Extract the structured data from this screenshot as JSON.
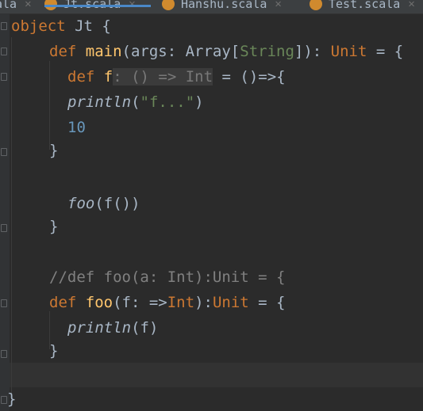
{
  "tabs": [
    {
      "label": "ala",
      "active": false
    },
    {
      "label": "Jt.scala",
      "active": true
    },
    {
      "label": "Hanshu.scala",
      "active": false
    },
    {
      "label": "Test.scala",
      "active": false
    }
  ],
  "code": {
    "l1": {
      "kw": "object",
      "name": " Jt {"
    },
    "l2": {
      "kw": "def ",
      "fn": "main",
      "p1": "(args: Array[",
      "ty": "String",
      "p2": "]): ",
      "unit": "Unit",
      "p3": " = {"
    },
    "l3": {
      "kw": "def ",
      "name": "f",
      "hint": ": () => Int",
      "rest": " = ()=>{"
    },
    "l4": {
      "call": "println",
      "p1": "(",
      "str": "\"f...\"",
      "p2": ")"
    },
    "l5": {
      "num": "10"
    },
    "l6": {
      "text": "}"
    },
    "l7": {
      "call": "foo",
      "rest": "(f())"
    },
    "l8": {
      "text": "}"
    },
    "l9": {
      "comment": "//def foo(a: Int):Unit = {"
    },
    "l10": {
      "kw": "def ",
      "fn": "foo",
      "p1": "(f: =>",
      "ty": "Int",
      "p2": "):",
      "unit": "Unit",
      "p3": " = {"
    },
    "l11": {
      "call": "println",
      "rest": "(f)"
    },
    "l12": {
      "text": "}"
    },
    "l13": {
      "text": "}"
    }
  },
  "colors": {
    "background": "#2b2b2b",
    "keyword": "#cc7832",
    "function": "#ffc66d",
    "string": "#6a8759",
    "number": "#6897bb",
    "comment": "#808080",
    "tab_accent": "#4a88c7"
  }
}
